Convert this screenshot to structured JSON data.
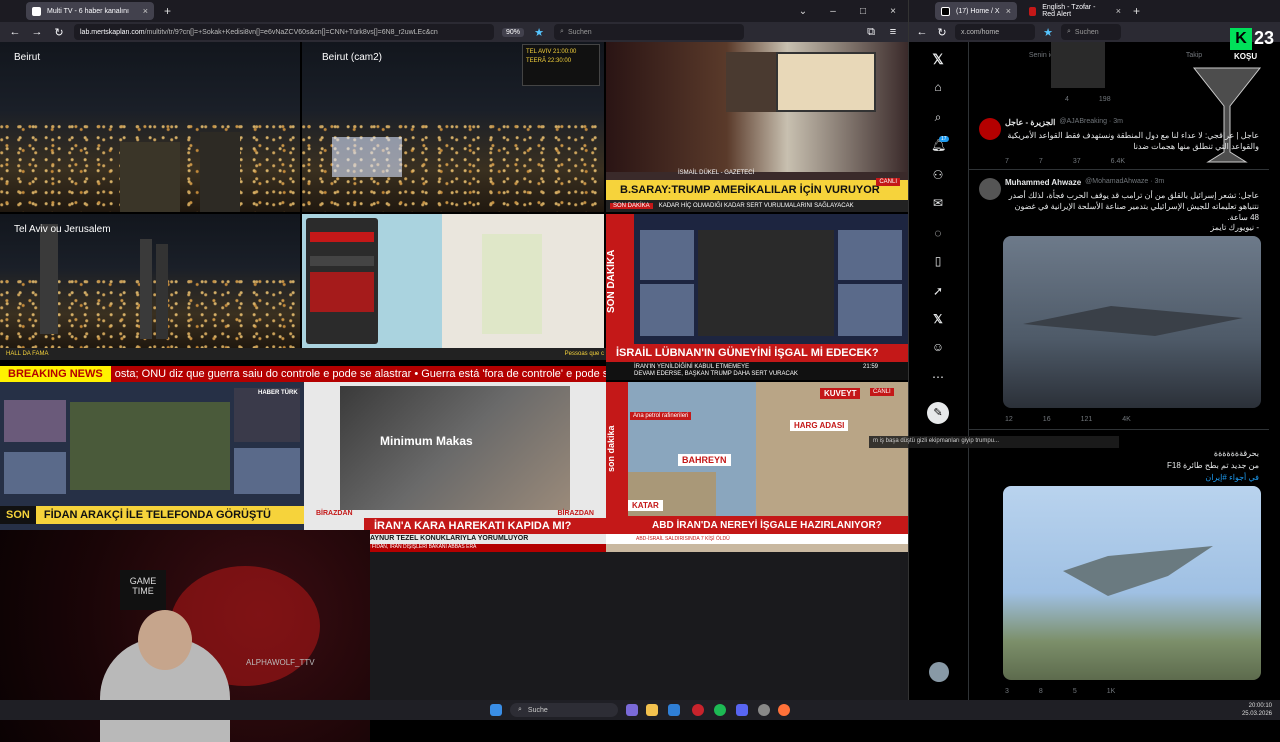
{
  "left_browser": {
    "tab_title": "Multi TV - 6 haber kanalını",
    "url_host": "lab.mertskaplan.com",
    "url_path": "/multitv/tr/9?cn[]=+Sokak+Kedisi8vn[]=e6vNaZCV60s&cn[]=CNN+Türk8vs[]=6N8_r2uwLEc&cn",
    "zoom": "90%",
    "search_placeholder": "Suchen"
  },
  "grid": {
    "beirut": "Beirut",
    "beirut_cam2": "Beirut (cam2)",
    "telaviv": "Tel Aviv ou Jerusalem",
    "cnn_overlay_line1": "TEL AVIV  21:00:00",
    "cnn_overlay_line2": "TEERÃ  22:30:00",
    "cnn_headline": "B.SARAY:TRUMP AMERİKALILAR İÇİN VURUYOR",
    "cnn_sub": "KADAR HİÇ OLMADIĞI KADAR SERT VURULMALARINI SAĞLAYACAK",
    "cnn_person": "İSMAİL DÜKEL - GAZETECİ",
    "ntv_headline": "İSRAİL LÜBNAN'IN GÜNEYİNİ İŞGAL Mİ EDECEK?",
    "ntv_sub1": "İRAN'IN YENİLDİĞİNİ KABUL ETMEMEYE",
    "ntv_sub2": "DEVAM EDERSE, BAŞKAN TRUMP DAHA SERT VURACAK",
    "ntv_time": "21:59",
    "ntv_side": "SON DAKİKA",
    "hall": "HALL DA FAMA",
    "pessoas": "Pessoas que c",
    "breaking": "BREAKING NEWS",
    "ticker_text": "osta; ONU diz que guerra saiu do controle e pode se alastrar  •  Guerra está 'fora de controle' e pode se al",
    "haber_headline": "FİDAN ARAKÇİ İLE TELEFONDA GÖRÜŞTÜ",
    "haber_son": "SON",
    "haber_logo": "HABER TÜRK",
    "minimum": "Minimum Makas",
    "birazdan": "BİRAZDAN",
    "global_headline": "İRAN'A KARA HAREKATI KAPIDA MI?",
    "global_sub": "AYNUR TEZEL KONUKLARIYLA YORUMLUYOR",
    "global_ticker": "DIŞİŞLERİ BAKANI HAKAN FİDAN, İRAN DIŞİŞLERİ BAKANI ABBAS ERA",
    "a_headline": "ABD İRAN'DA NEREYİ İŞGALE HAZIRLANIYOR?",
    "a_kuveyt": "KUVEYT",
    "a_harg": "HARG ADASI",
    "a_bahreyn": "BAHREYN",
    "a_katar": "KATAR",
    "a_petrol": "Ana petrol rafinerileri",
    "a_canli": "CANLI",
    "a_son": "son dakika",
    "a_ticker": "ABD-İSRAİL SALDIRISINDA 7 KİŞİ ÖLDÜ",
    "cnn_canli": "CANLI",
    "cnn_sondakika": "SON DAKİKA"
  },
  "webcam": {
    "game_time": "GAME TIME",
    "wolf": "ALPHAWOLF_TTV"
  },
  "taskbar": {
    "search": "Suche",
    "time": "20:00:10",
    "date": "25.03.2026"
  },
  "right_browser": {
    "tab1": "(17) Home / X",
    "tab2": "English - Tzofar - Red Alert",
    "url": "x.com/home",
    "search": "Suchen",
    "badge": "17",
    "kosu_num": "23",
    "kosu_label": "KOŞU"
  },
  "feed": {
    "tabs": [
      "Senin için",
      "Takip"
    ],
    "t0_actions": [
      "",
      "",
      "4",
      "198"
    ],
    "t1_name": "الجزيرة - عاجل",
    "t1_handle": "@AJABreaking · 3m",
    "t1_text": "عاجل | عراقجي: لا عداء لنا مع دول المنطقة ونستهدف فقط القواعد الأمريكية والقواعد التي تنطلق منها هجمات ضدنا",
    "t1_actions": [
      "7",
      "7",
      "37",
      "6.4K"
    ],
    "t2_name": "Muhammed Ahwaze",
    "t2_handle": "@MohamadAhwaze · 3m",
    "t2_text": "عاجل: تشعر إسرائيل بالقلق من أن ترامب قد يوقف الحرب فجأة، لذلك أصدر نتنياهو تعليماته للجيش الإسرائيلي بتدمير صناعة الأسلحة الإيرانية في غضون 48 ساعة.",
    "t2_src": "- نيويورك تايمز",
    "t2_actions": [
      "12",
      "16",
      "121",
      "4K"
    ],
    "overlay_text": "m iş başa düştü gizli ekipmanları giyip trumpu...",
    "t3_text": "بحرقةةةةةةة",
    "t3_text2": "من جديد تم بطح طائرة F18",
    "t3_text3": "في أجواء #إيران",
    "t3_actions": [
      "3",
      "8",
      "5",
      "1K"
    ]
  }
}
